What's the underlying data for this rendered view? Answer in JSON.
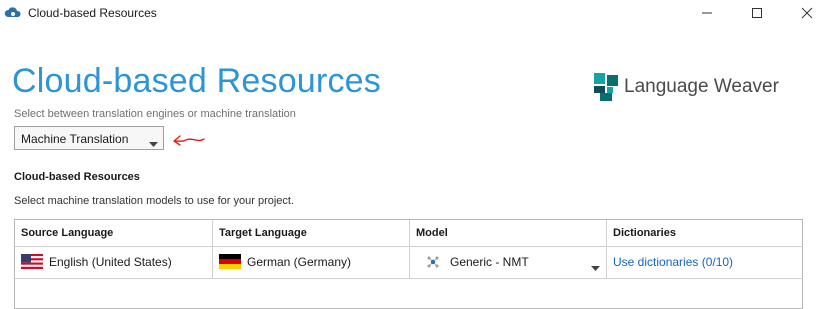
{
  "window": {
    "title": "Cloud-based Resources",
    "controls": [
      "minimize-icon",
      "maximize-icon",
      "close-icon"
    ]
  },
  "header": {
    "title": "Cloud-based Resources",
    "brand": "Language Weaver",
    "brand_colors": {
      "teal": "#0b6e6e",
      "dark": "#0e4f57",
      "accent": "#17a3a3"
    }
  },
  "engine": {
    "instruction": "Select between translation engines or machine translation",
    "selected": "Machine Translation",
    "annotation_color": "#e02020"
  },
  "resources": {
    "heading": "Cloud-based Resources",
    "description": "Select machine translation models to use for your project."
  },
  "grid": {
    "columns": [
      "Source Language",
      "Target Language",
      "Model",
      "Dictionaries"
    ],
    "rows": [
      {
        "source": "English (United States)",
        "source_flag": "us-flag-icon",
        "target": "German (Germany)",
        "target_flag": "de-flag-icon",
        "model": "Generic - NMT",
        "model_icon": "network-icon",
        "dictionaries": "Use dictionaries (0/10)"
      }
    ]
  },
  "colors": {
    "title_blue": "#2b95d6",
    "link_blue": "#1565c0"
  }
}
